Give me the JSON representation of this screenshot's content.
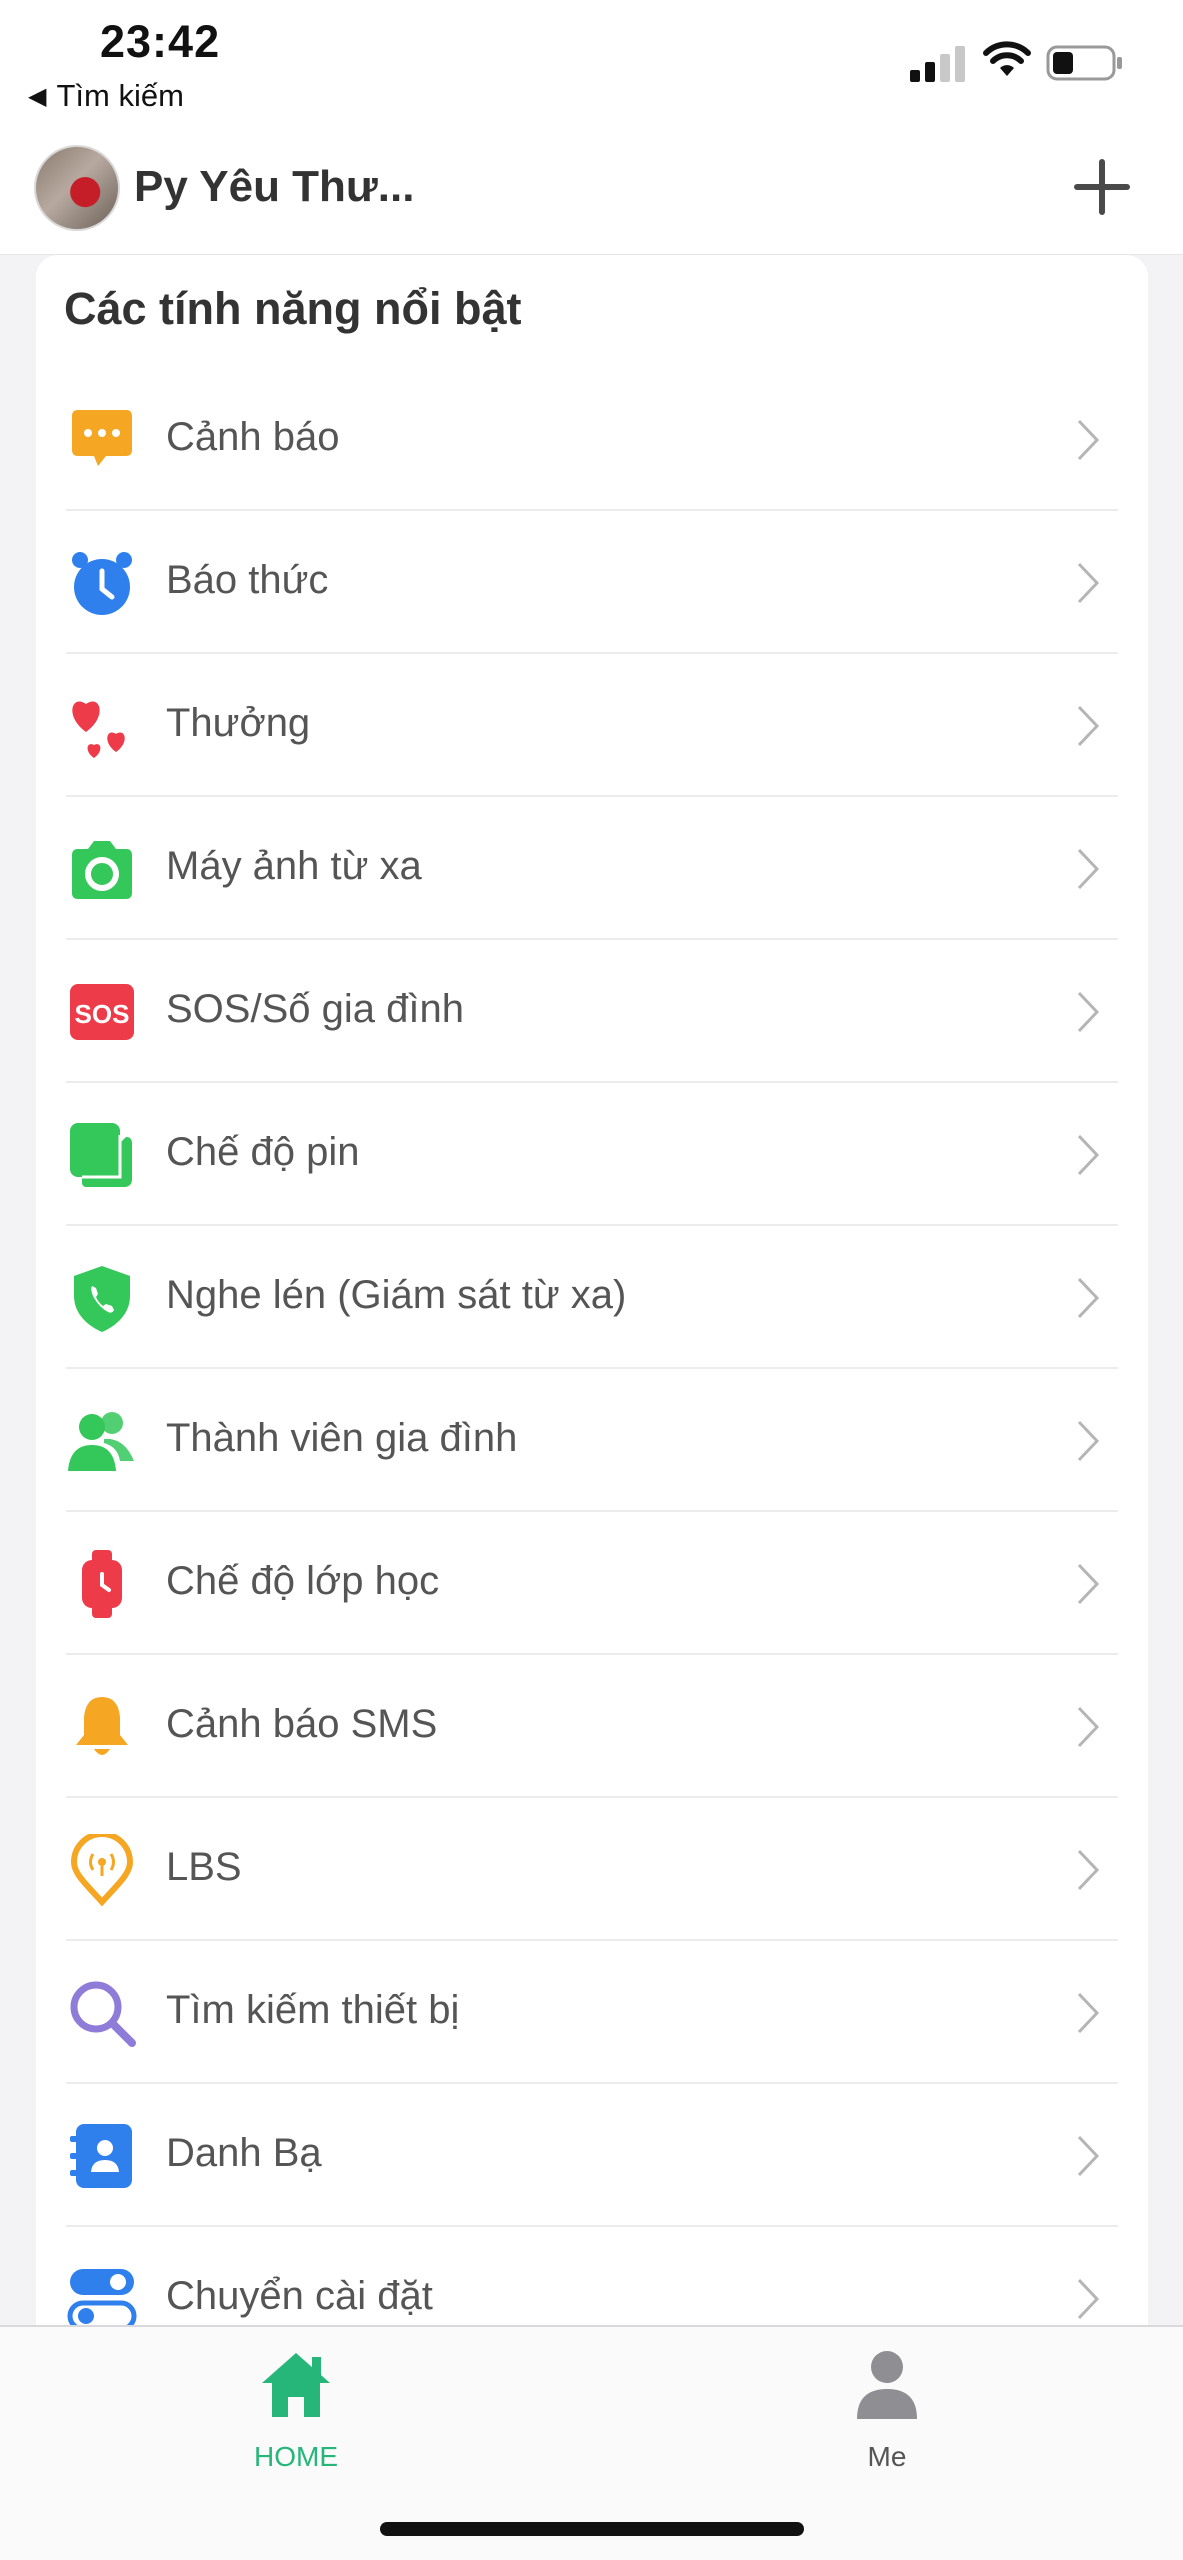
{
  "status_bar": {
    "time": "23:42",
    "back_app": "Tìm kiếm",
    "icons": [
      "signal-icon",
      "wifi-icon",
      "battery-icon"
    ]
  },
  "header": {
    "device_name": "Py Yêu Thư...",
    "add_icon": "plus-icon"
  },
  "features": {
    "title": "Các tính năng nổi bật",
    "items": [
      {
        "label": "Cảnh báo",
        "icon": "chat-bubble-icon",
        "color": "#f5a623"
      },
      {
        "label": "Báo thức",
        "icon": "alarm-clock-icon",
        "color": "#2f80ed"
      },
      {
        "label": "Thưởng",
        "icon": "hearts-icon",
        "color": "#ee3b4a"
      },
      {
        "label": "Máy ảnh từ xa",
        "icon": "camera-icon",
        "color": "#34c759"
      },
      {
        "label": "SOS/Số gia đình",
        "icon": "sos-icon",
        "color": "#ee3b4a",
        "icon_text": "SOS"
      },
      {
        "label": "Chế độ pin",
        "icon": "battery-mode-icon",
        "color": "#34c759"
      },
      {
        "label": "Nghe lén (Giám sát từ xa)",
        "icon": "shield-phone-icon",
        "color": "#34c759"
      },
      {
        "label": "Thành viên gia đình",
        "icon": "family-members-icon",
        "color": "#34c759"
      },
      {
        "label": "Chế độ lớp học",
        "icon": "watch-icon",
        "color": "#ee3b4a"
      },
      {
        "label": "Cảnh báo SMS",
        "icon": "bell-icon",
        "color": "#f5a623"
      },
      {
        "label": "LBS",
        "icon": "location-pin-icon",
        "color": "#f5a623"
      },
      {
        "label": "Tìm kiếm thiết bị",
        "icon": "search-icon",
        "color": "#8e7cd8"
      },
      {
        "label": "Danh Bạ",
        "icon": "contacts-icon",
        "color": "#2f80ed"
      },
      {
        "label": "Chuyển cài đặt",
        "icon": "toggle-settings-icon",
        "color": "#2f80ed"
      }
    ]
  },
  "tabbar": {
    "home": {
      "label": "HOME",
      "color": "#27b67a"
    },
    "me": {
      "label": "Me",
      "color": "#555555"
    }
  }
}
